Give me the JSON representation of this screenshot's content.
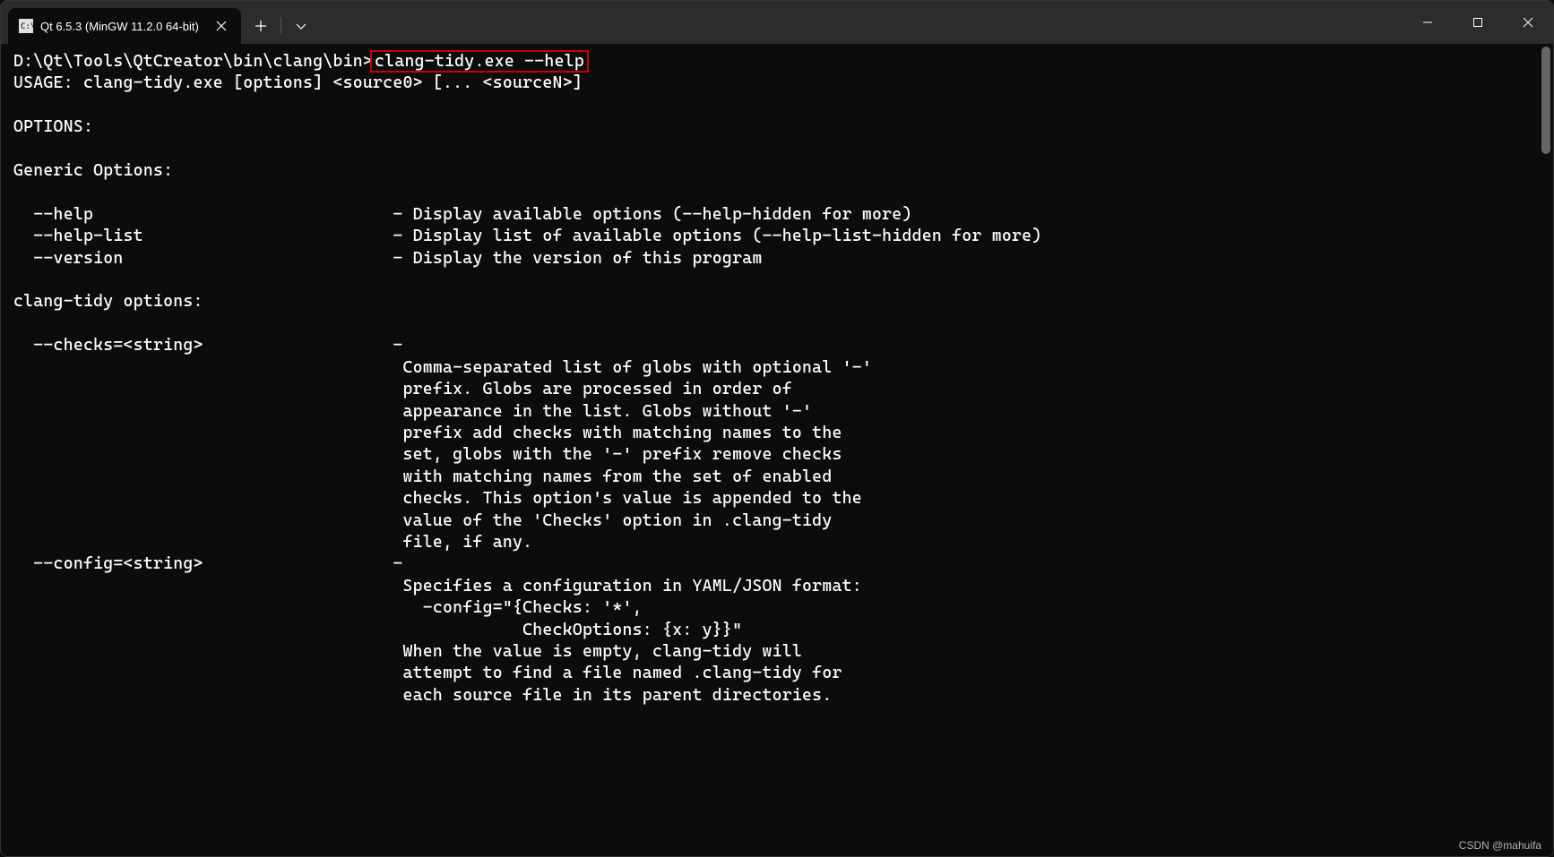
{
  "tab": {
    "title": "Qt 6.5.3 (MinGW 11.2.0 64-bit)",
    "icon_label": "cmd"
  },
  "prompt": {
    "path": "D:\\Qt\\Tools\\QtCreator\\bin\\clang\\bin>",
    "command": "clang-tidy.exe --help"
  },
  "output": {
    "usage": "USAGE: clang-tidy.exe [options] <source0> [... <sourceN>]",
    "options_header": "OPTIONS:",
    "generic_header": "Generic Options:",
    "generic": [
      {
        "flag": "  --help",
        "desc": "                              - Display available options (--help-hidden for more)"
      },
      {
        "flag": "  --help-list",
        "desc": "                         - Display list of available options (--help-list-hidden for more)"
      },
      {
        "flag": "  --version",
        "desc": "                           - Display the version of this program"
      }
    ],
    "clang_header": "clang-tidy options:",
    "checks_flag": "  --checks=<string>",
    "checks_dash": "                   -",
    "checks_desc": [
      "                                       Comma-separated list of globs with optional '-'",
      "                                       prefix. Globs are processed in order of",
      "                                       appearance in the list. Globs without '-'",
      "                                       prefix add checks with matching names to the",
      "                                       set, globs with the '-' prefix remove checks",
      "                                       with matching names from the set of enabled",
      "                                       checks. This option's value is appended to the",
      "                                       value of the 'Checks' option in .clang-tidy",
      "                                       file, if any."
    ],
    "config_flag": "  --config=<string>",
    "config_dash": "                   -",
    "config_desc": [
      "                                       Specifies a configuration in YAML/JSON format:",
      "                                         -config=\"{Checks: '*',",
      "                                                   CheckOptions: {x: y}}\"",
      "                                       When the value is empty, clang-tidy will",
      "                                       attempt to find a file named .clang-tidy for",
      "                                       each source file in its parent directories."
    ]
  },
  "watermark": "CSDN @mahuifa"
}
